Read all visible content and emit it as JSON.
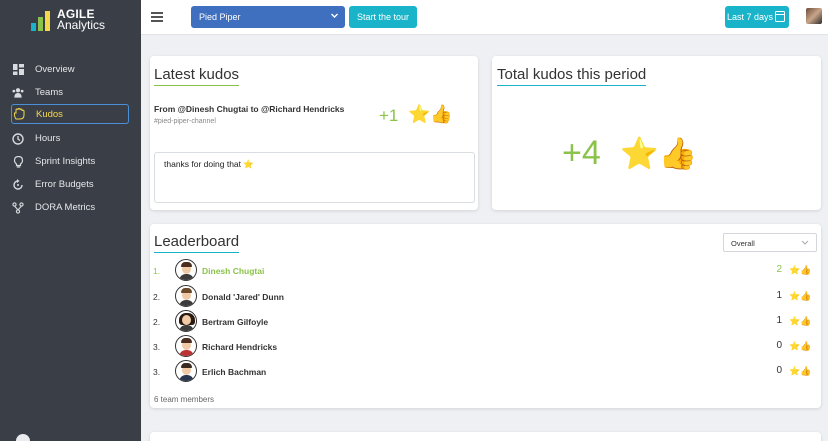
{
  "logo": {
    "line1": "AGILE",
    "line2": "Analytics",
    "bar_colors": [
      "#19b4c9",
      "#8bc34a",
      "#f5d84a"
    ]
  },
  "sidebar": {
    "items": [
      {
        "label": "Overview",
        "icon": "dashboard-icon",
        "active": false
      },
      {
        "label": "Teams",
        "icon": "team-icon",
        "active": false
      },
      {
        "label": "Kudos",
        "icon": "hand-icon",
        "active": true
      },
      {
        "label": "Hours",
        "icon": "clock-icon",
        "active": false
      },
      {
        "label": "Sprint Insights",
        "icon": "lightbulb-icon",
        "active": false
      },
      {
        "label": "Error Budgets",
        "icon": "refresh-icon",
        "active": false
      },
      {
        "label": "DORA Metrics",
        "icon": "flow-icon",
        "active": false
      }
    ]
  },
  "topbar": {
    "project": "Pied Piper",
    "tour_label": "Start the tour",
    "period_label": "Last 7 days"
  },
  "latest_kudos": {
    "title": "Latest kudos",
    "from_text": "From @Dinesh Chugtai to @Richard Hendricks",
    "channel": "#pied-piper-channel",
    "score": "+1",
    "emoji": "⭐👍",
    "message": "thanks for doing that ⭐"
  },
  "total_kudos": {
    "title": "Total kudos this period",
    "value": "+4",
    "emoji": "⭐👍"
  },
  "leaderboard": {
    "title": "Leaderboard",
    "filter": "Overall",
    "rows": [
      {
        "rank": "1.",
        "name": "Dinesh Chugtai",
        "count": "2",
        "emoji": "⭐👍"
      },
      {
        "rank": "2.",
        "name": "Donald 'Jared' Dunn",
        "count": "1",
        "emoji": "⭐👍"
      },
      {
        "rank": "2.",
        "name": "Bertram Gilfoyle",
        "count": "1",
        "emoji": "⭐👍"
      },
      {
        "rank": "3.",
        "name": "Richard Hendricks",
        "count": "0",
        "emoji": "⭐👍"
      },
      {
        "rank": "3.",
        "name": "Erlich Bachman",
        "count": "0",
        "emoji": "⭐👍"
      }
    ],
    "members_text": "6  team members"
  },
  "colors": {
    "accent_green": "#8bc34a",
    "accent_teal": "#19b4c9",
    "select_blue": "#3f6fbf",
    "sidebar_bg": "#3a3f47"
  }
}
